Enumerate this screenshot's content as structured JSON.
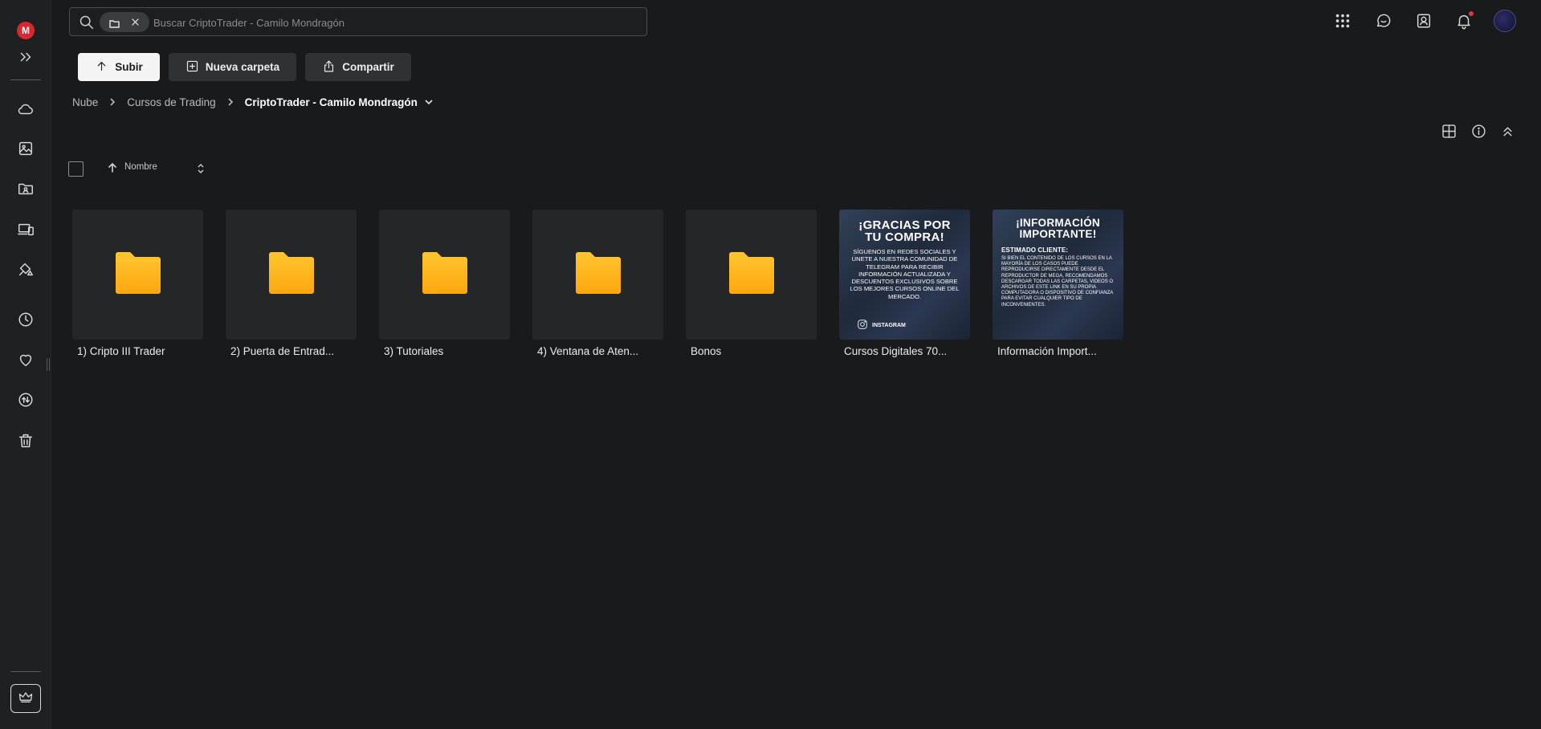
{
  "sidebar": {
    "logo": "M",
    "items": [
      "expand",
      "cloud-drive",
      "photos",
      "shared-items",
      "devices",
      "rubbish-bin-settings",
      "recents",
      "favourites",
      "transfers",
      "rubbish-bin",
      "upgrade"
    ]
  },
  "search": {
    "placeholder": "Buscar CriptoTrader - Camilo Mondragón"
  },
  "toolbar": {
    "upload_label": "Subir",
    "new_folder_label": "Nueva carpeta",
    "share_label": "Compartir"
  },
  "breadcrumb": {
    "items": [
      "Nube",
      "Cursos de Trading"
    ],
    "current": "CriptoTrader - Camilo Mondragón"
  },
  "sort": {
    "label": "Nombre"
  },
  "files": [
    {
      "name": "1) Cripto III Trader",
      "type": "folder"
    },
    {
      "name": "2) Puerta de Entrad...",
      "type": "folder"
    },
    {
      "name": "3) Tutoriales",
      "type": "folder"
    },
    {
      "name": "4) Ventana de Aten...",
      "type": "folder"
    },
    {
      "name": "Bonos",
      "type": "folder"
    },
    {
      "name": "Cursos Digitales 70...",
      "type": "image"
    },
    {
      "name": "Información Import...",
      "type": "image"
    }
  ],
  "poster1": {
    "title_line1": "¡GRACIAS POR",
    "title_line2": "TU COMPRA!",
    "body": "SÍGUENOS EN REDES SOCIALES Y ÚNETE A NUESTRA COMUNIDAD DE TELEGRAM PARA RECIBIR INFORMACIÓN ACTUALIZADA Y DESCUENTOS EXCLUSIVOS SOBRE LOS MEJORES CURSOS ONLINE DEL MERCADO.",
    "social": "INSTAGRAM"
  },
  "poster2": {
    "title_line1": "¡INFORMACIÓN",
    "title_line2": "IMPORTANTE!",
    "subtitle": "ESTIMADO CLIENTE:",
    "body": "SI BIEN EL CONTENIDO DE LOS CURSOS EN LA MAYORÍA DE LOS CASOS PUEDE REPRODUCIRSE DIRECTAMENTE DESDE EL REPRODUCTOR DE MEGA, RECOMENDAMOS DESCARGAR TODAS LAS CARPETAS, VIDEOS O ARCHIVOS DE ESTE LINK EN SU PROPIA COMPUTADORA O DISPOSITIVO DE CONFIANZA PARA EVITAR CUALQUIER TIPO DE INCONVENIENTES."
  },
  "colors": {
    "background": "#181a1b",
    "tile": "#242628",
    "folder": "#ffb81f",
    "accent_red": "#d9272e"
  }
}
